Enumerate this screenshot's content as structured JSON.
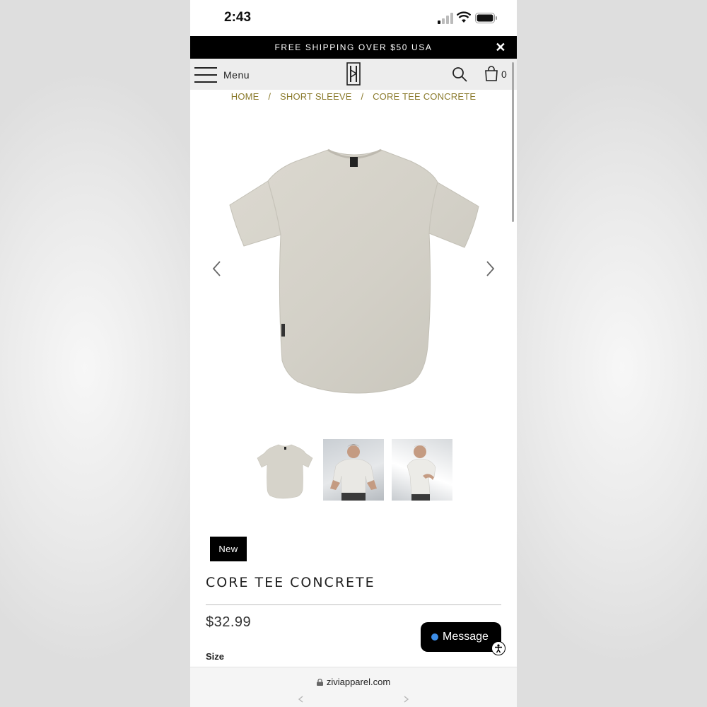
{
  "status_bar": {
    "time": "2:43"
  },
  "promo": {
    "text": "FREE SHIPPING OVER $50 USA",
    "close_symbol": "✕"
  },
  "header": {
    "menu_label": "Menu",
    "cart_count": "0"
  },
  "breadcrumb": {
    "items": [
      "HOME",
      "SHORT SLEEVE",
      "CORE TEE CONCRETE"
    ],
    "separator": "/"
  },
  "product": {
    "badge": "New",
    "title": "CORE TEE CONCRETE",
    "price": "$32.99",
    "size_label": "Size",
    "color": "#d8d5cc"
  },
  "chat": {
    "label": "Message"
  },
  "browser": {
    "url": "ziviapparel.com"
  },
  "colors": {
    "breadcrumb": "#8a7a2b",
    "promo_bg": "#000000",
    "header_bg": "#ededed",
    "chat_dot": "#3d8ee8"
  },
  "icons": [
    "signal-icon",
    "wifi-icon",
    "battery-icon",
    "close-icon",
    "hamburger-icon",
    "logo",
    "search-icon",
    "bag-icon",
    "chevron-left-icon",
    "chevron-right-icon",
    "accessibility-icon",
    "lock-icon"
  ]
}
